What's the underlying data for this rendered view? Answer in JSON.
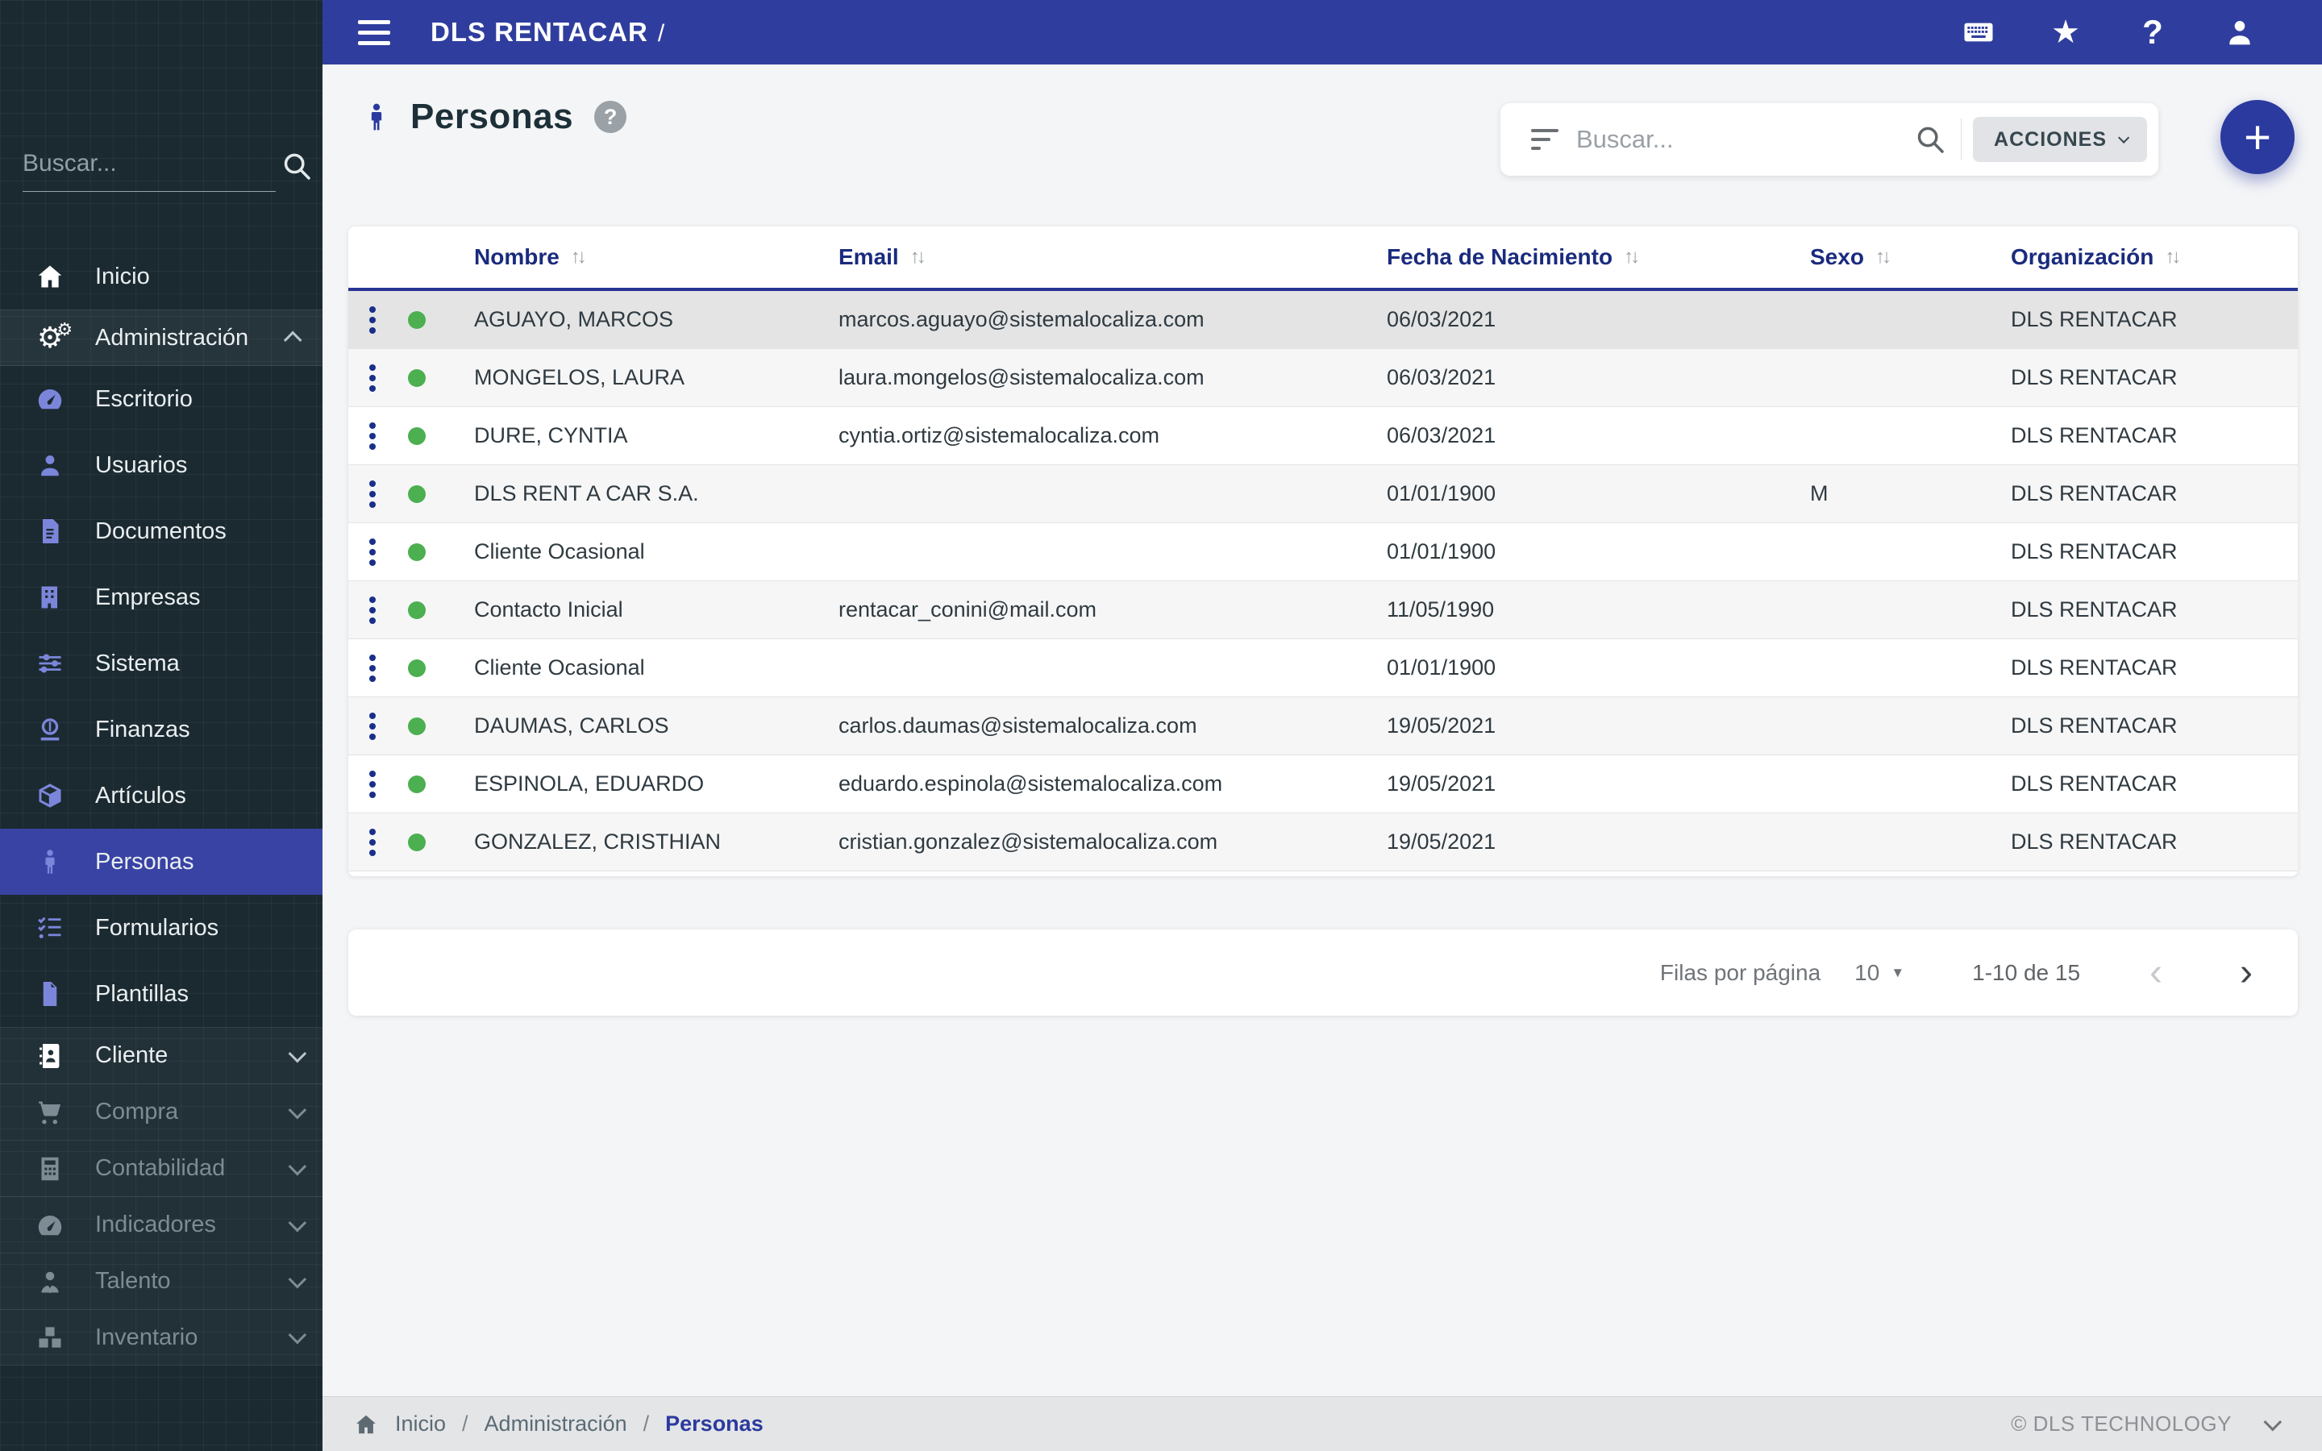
{
  "topbar": {
    "title": "DLS RENTACAR",
    "slash": "/"
  },
  "icons": {
    "star": "★",
    "help": "?",
    "gear": "⚙",
    "sort": "↑↓",
    "plus": "+",
    "prev": "‹",
    "next": "›",
    "dropdown": "▼"
  },
  "sidebar": {
    "search_placeholder": "Buscar...",
    "items": [
      {
        "label": "Inicio",
        "icon": "home-icon"
      },
      {
        "label": "Administración",
        "icon": "gears-icon"
      },
      {
        "label": "Escritorio",
        "icon": "dashboard-icon"
      },
      {
        "label": "Usuarios",
        "icon": "user-icon"
      },
      {
        "label": "Documentos",
        "icon": "document-icon"
      },
      {
        "label": "Empresas",
        "icon": "building-icon"
      },
      {
        "label": "Sistema",
        "icon": "sliders-icon"
      },
      {
        "label": "Finanzas",
        "icon": "finance-icon"
      },
      {
        "label": "Artículos",
        "icon": "cube-icon"
      },
      {
        "label": "Personas",
        "icon": "person-icon"
      },
      {
        "label": "Formularios",
        "icon": "checklist-icon"
      },
      {
        "label": "Plantillas",
        "icon": "file-icon"
      },
      {
        "label": "Cliente",
        "icon": "contacts-icon"
      },
      {
        "label": "Compra",
        "icon": "cart-icon"
      },
      {
        "label": "Contabilidad",
        "icon": "calculator-icon"
      },
      {
        "label": "Indicadores",
        "icon": "gauge-icon"
      },
      {
        "label": "Talento",
        "icon": "person-tie-icon"
      },
      {
        "label": "Inventario",
        "icon": "boxes-icon"
      }
    ]
  },
  "page": {
    "title": "Personas"
  },
  "toolbar": {
    "search_placeholder": "Buscar...",
    "actions_label": "ACCIONES"
  },
  "table": {
    "columns": [
      "Nombre",
      "Email",
      "Fecha de Nacimiento",
      "Sexo",
      "Organización"
    ],
    "rows": [
      {
        "nombre": "AGUAYO, MARCOS",
        "email": "marcos.aguayo@sistemalocaliza.com",
        "fecha": "06/03/2021",
        "sexo": "",
        "org": "DLS RENTACAR"
      },
      {
        "nombre": "MONGELOS, LAURA",
        "email": "laura.mongelos@sistemalocaliza.com",
        "fecha": "06/03/2021",
        "sexo": "",
        "org": "DLS RENTACAR"
      },
      {
        "nombre": "DURE, CYNTIA",
        "email": "cyntia.ortiz@sistemalocaliza.com",
        "fecha": "06/03/2021",
        "sexo": "",
        "org": "DLS RENTACAR"
      },
      {
        "nombre": "DLS RENT A CAR S.A.",
        "email": "",
        "fecha": "01/01/1900",
        "sexo": "M",
        "org": "DLS RENTACAR"
      },
      {
        "nombre": "Cliente Ocasional",
        "email": "",
        "fecha": "01/01/1900",
        "sexo": "",
        "org": "DLS RENTACAR"
      },
      {
        "nombre": "Contacto Inicial",
        "email": "rentacar_conini@mail.com",
        "fecha": "11/05/1990",
        "sexo": "",
        "org": "DLS RENTACAR"
      },
      {
        "nombre": "Cliente Ocasional",
        "email": "",
        "fecha": "01/01/1900",
        "sexo": "",
        "org": "DLS RENTACAR"
      },
      {
        "nombre": "DAUMAS, CARLOS",
        "email": "carlos.daumas@sistemalocaliza.com",
        "fecha": "19/05/2021",
        "sexo": "",
        "org": "DLS RENTACAR"
      },
      {
        "nombre": "ESPINOLA, EDUARDO",
        "email": "eduardo.espinola@sistemalocaliza.com",
        "fecha": "19/05/2021",
        "sexo": "",
        "org": "DLS RENTACAR"
      },
      {
        "nombre": "GONZALEZ, CRISTHIAN",
        "email": "cristian.gonzalez@sistemalocaliza.com",
        "fecha": "19/05/2021",
        "sexo": "",
        "org": "DLS RENTACAR"
      }
    ]
  },
  "pagination": {
    "rows_per_page_label": "Filas por página",
    "rows_per_page": "10",
    "range": "1-10 de 15"
  },
  "footer": {
    "breadcrumb": [
      "Inicio",
      "Administración",
      "Personas"
    ],
    "separator": "/",
    "copyright": "© DLS TECHNOLOGY"
  }
}
